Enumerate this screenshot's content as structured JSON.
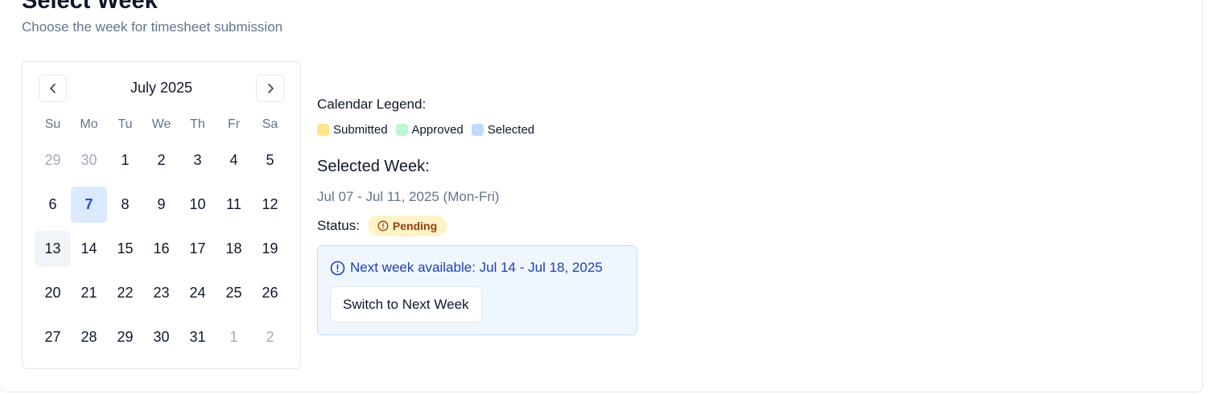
{
  "header": {
    "title": "Select Week",
    "subtitle": "Choose the week for timesheet submission"
  },
  "calendar": {
    "month_label": "July 2025",
    "prev_icon": "chevron-left-icon",
    "next_icon": "chevron-right-icon",
    "weekdays": [
      "Su",
      "Mo",
      "Tu",
      "We",
      "Th",
      "Fr",
      "Sa"
    ],
    "days": [
      {
        "label": "29",
        "state": "outside"
      },
      {
        "label": "30",
        "state": "outside"
      },
      {
        "label": "1",
        "state": "normal"
      },
      {
        "label": "2",
        "state": "normal"
      },
      {
        "label": "3",
        "state": "normal"
      },
      {
        "label": "4",
        "state": "normal"
      },
      {
        "label": "5",
        "state": "normal"
      },
      {
        "label": "6",
        "state": "normal"
      },
      {
        "label": "7",
        "state": "selected"
      },
      {
        "label": "8",
        "state": "normal"
      },
      {
        "label": "9",
        "state": "normal"
      },
      {
        "label": "10",
        "state": "normal"
      },
      {
        "label": "11",
        "state": "normal"
      },
      {
        "label": "12",
        "state": "normal"
      },
      {
        "label": "13",
        "state": "today"
      },
      {
        "label": "14",
        "state": "normal"
      },
      {
        "label": "15",
        "state": "normal"
      },
      {
        "label": "16",
        "state": "normal"
      },
      {
        "label": "17",
        "state": "normal"
      },
      {
        "label": "18",
        "state": "normal"
      },
      {
        "label": "19",
        "state": "normal"
      },
      {
        "label": "20",
        "state": "normal"
      },
      {
        "label": "21",
        "state": "normal"
      },
      {
        "label": "22",
        "state": "normal"
      },
      {
        "label": "23",
        "state": "normal"
      },
      {
        "label": "24",
        "state": "normal"
      },
      {
        "label": "25",
        "state": "normal"
      },
      {
        "label": "26",
        "state": "normal"
      },
      {
        "label": "27",
        "state": "normal"
      },
      {
        "label": "28",
        "state": "normal"
      },
      {
        "label": "29",
        "state": "normal"
      },
      {
        "label": "30",
        "state": "normal"
      },
      {
        "label": "31",
        "state": "normal"
      },
      {
        "label": "1",
        "state": "outside"
      },
      {
        "label": "2",
        "state": "outside"
      }
    ]
  },
  "legend": {
    "title": "Calendar Legend:",
    "items": [
      {
        "label": "Submitted",
        "color": "#fde68a"
      },
      {
        "label": "Approved",
        "color": "#bbf7d0"
      },
      {
        "label": "Selected",
        "color": "#bfdbfe"
      }
    ]
  },
  "selection": {
    "title": "Selected Week:",
    "range": "Jul 07 - Jul 11, 2025 (Mon-Fri)",
    "status_label": "Status:",
    "status_value": "Pending",
    "status_icon": "alert-circle-icon"
  },
  "next_week": {
    "text": "Next week available: Jul 14 - Jul 18, 2025",
    "icon": "info-circle-icon",
    "button_label": "Switch to Next Week"
  }
}
